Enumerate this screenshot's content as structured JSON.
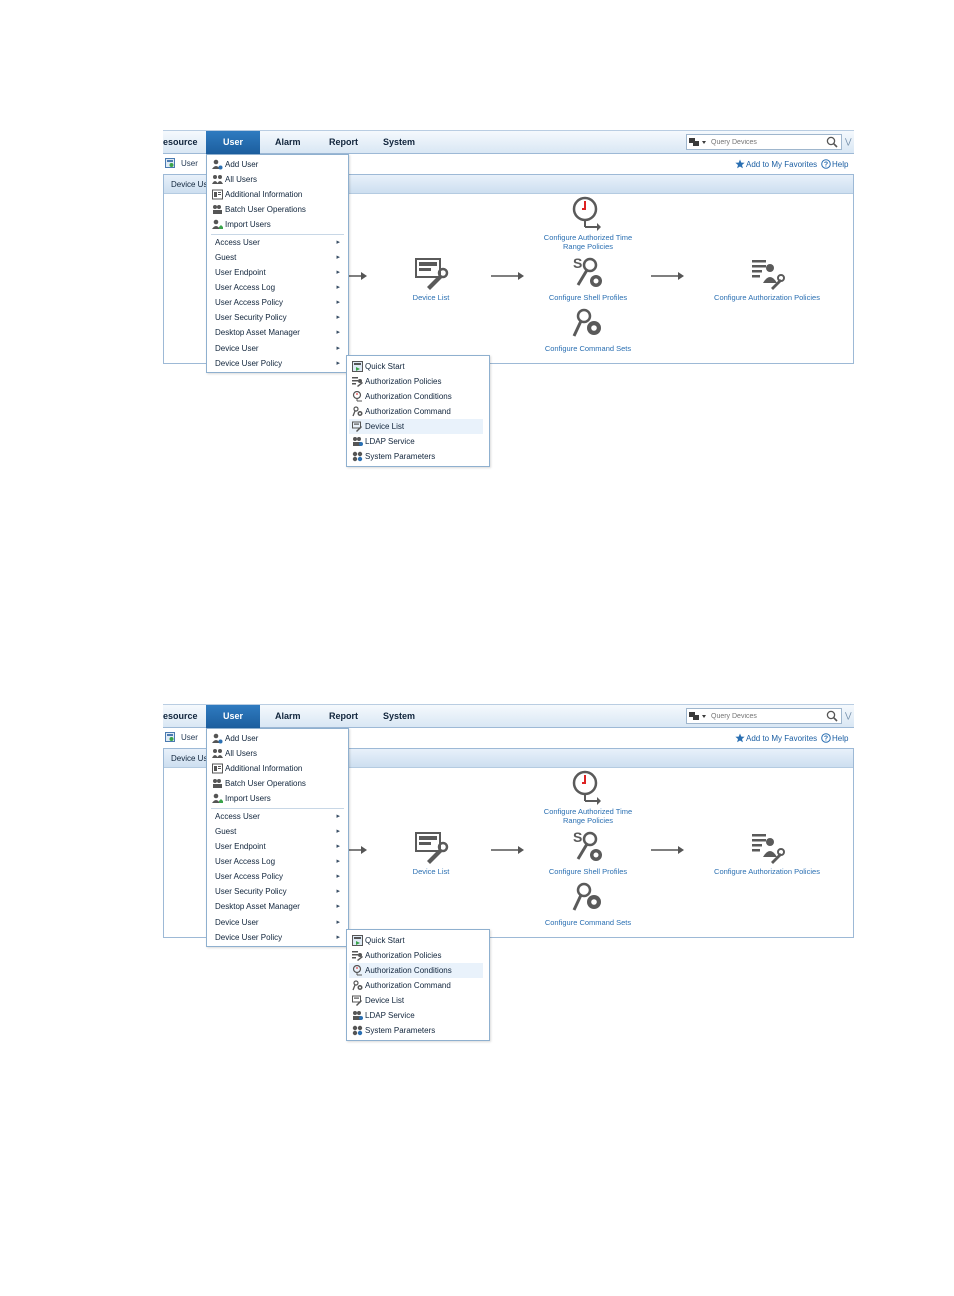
{
  "nav": {
    "tabs": [
      "esource",
      "User",
      "Alarm",
      "Report",
      "System"
    ],
    "search_placeholder": "Query Devices"
  },
  "subbar": {
    "crumb": "User",
    "favorites": "Add to My Favorites",
    "help": "Help"
  },
  "panel": {
    "title": "Device Us"
  },
  "workflow": {
    "device_list": "Device List",
    "time_range": "Configure Authorized Time Range Policies",
    "shell_profiles": "Configure Shell Profiles",
    "command_sets": "Configure Command Sets",
    "authorization": "Configure Authorization Policies"
  },
  "user_menu": {
    "items": [
      {
        "label": "Add User",
        "icon": "add-user-icon"
      },
      {
        "label": "All Users",
        "icon": "all-users-icon"
      },
      {
        "label": "Additional Information",
        "icon": "info-card-icon"
      },
      {
        "label": "Batch User Operations",
        "icon": "batch-users-icon"
      },
      {
        "label": "Import Users",
        "icon": "import-users-icon"
      }
    ],
    "submenus": [
      "Access User",
      "Guest",
      "User Endpoint",
      "User Access Log",
      "User Access Policy",
      "User Security Policy",
      "Desktop Asset Manager",
      "Device User",
      "Device User Policy"
    ]
  },
  "policy_menu": {
    "items": [
      {
        "label": "Quick Start",
        "icon": "quick-start-icon"
      },
      {
        "label": "Authorization Policies",
        "icon": "authorization-policies-icon"
      },
      {
        "label": "Authorization Conditions",
        "icon": "authorization-conditions-icon"
      },
      {
        "label": "Authorization Command",
        "icon": "authorization-command-icon"
      },
      {
        "label": "Device List",
        "icon": "device-list-icon"
      },
      {
        "label": "LDAP Service",
        "icon": "ldap-service-icon"
      },
      {
        "label": "System Parameters",
        "icon": "system-parameters-icon"
      }
    ]
  },
  "screenshots": [
    {
      "highlighted_policy_item": "Device List"
    },
    {
      "highlighted_policy_item": "Authorization Conditions"
    }
  ]
}
